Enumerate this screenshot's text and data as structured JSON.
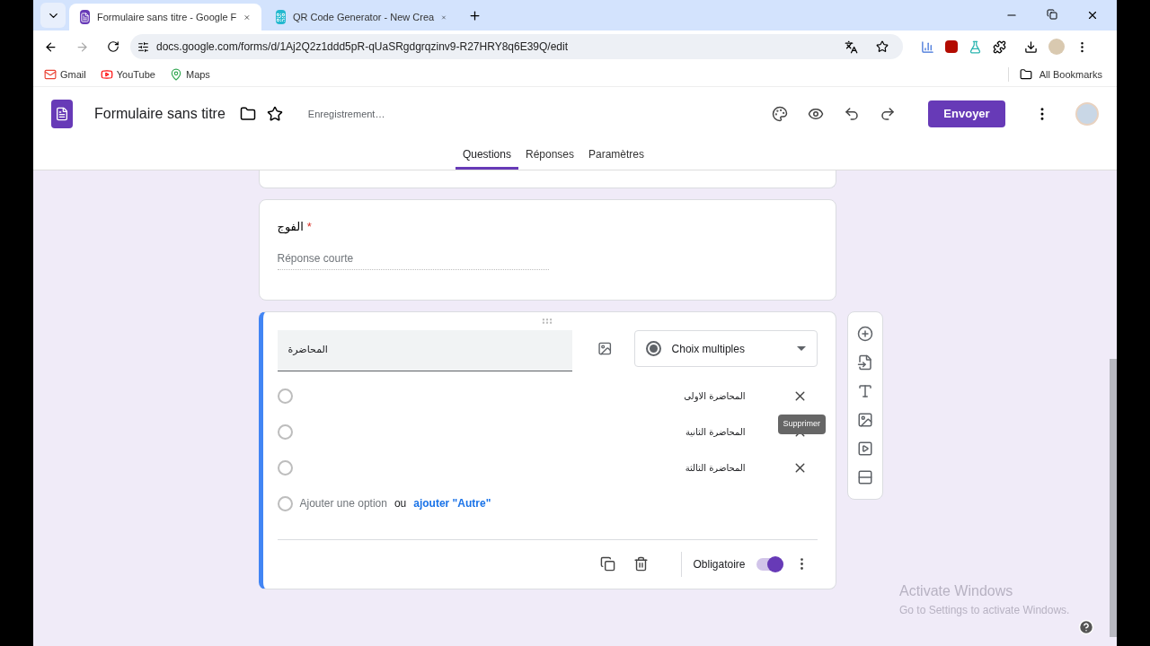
{
  "browser": {
    "tabs": [
      {
        "title": "Formulaire sans titre - Google F",
        "selected": true,
        "kind": "forms"
      },
      {
        "title": "QR Code Generator - New Crea",
        "selected": false,
        "kind": "qr"
      }
    ],
    "url": "docs.google.com/forms/d/1Aj2Q2z1ddd5pR-qUaSRgdgrqzinv9-R27HRY8q6E39Q/edit",
    "bookmarks": [
      {
        "label": "Gmail",
        "kind": "mail"
      },
      {
        "label": "YouTube",
        "kind": "video"
      },
      {
        "label": "Maps",
        "kind": "map"
      }
    ],
    "all_bookmarks": "All Bookmarks"
  },
  "header": {
    "title": "Formulaire sans titre",
    "status": "Enregistrement…",
    "send_button": "Envoyer",
    "tabs": [
      {
        "label": "Questions",
        "selected": true
      },
      {
        "label": "Réponses",
        "selected": false
      },
      {
        "label": "Paramètres",
        "selected": false
      }
    ]
  },
  "questions": [
    {
      "kind": "short",
      "title": "الفوج",
      "required": true,
      "required_mark": "*",
      "placeholder": "Réponse courte",
      "active": false
    },
    {
      "kind": "choice",
      "title": "المحاضرة",
      "active": true,
      "type": "Choix multiples",
      "options": [
        "المحاضرة الاولى",
        "المحاضرة الثانية",
        "المحاضرة الثالثة"
      ],
      "add_option": "Ajouter une option",
      "or": "ou",
      "add_other": "ajouter \"Autre\"",
      "required_label": "Obligatoire",
      "required": true,
      "tooltip": "Supprimer"
    }
  ],
  "watermark": {
    "title": "Activate Windows",
    "subtitle": "Go to Settings to activate Windows."
  }
}
